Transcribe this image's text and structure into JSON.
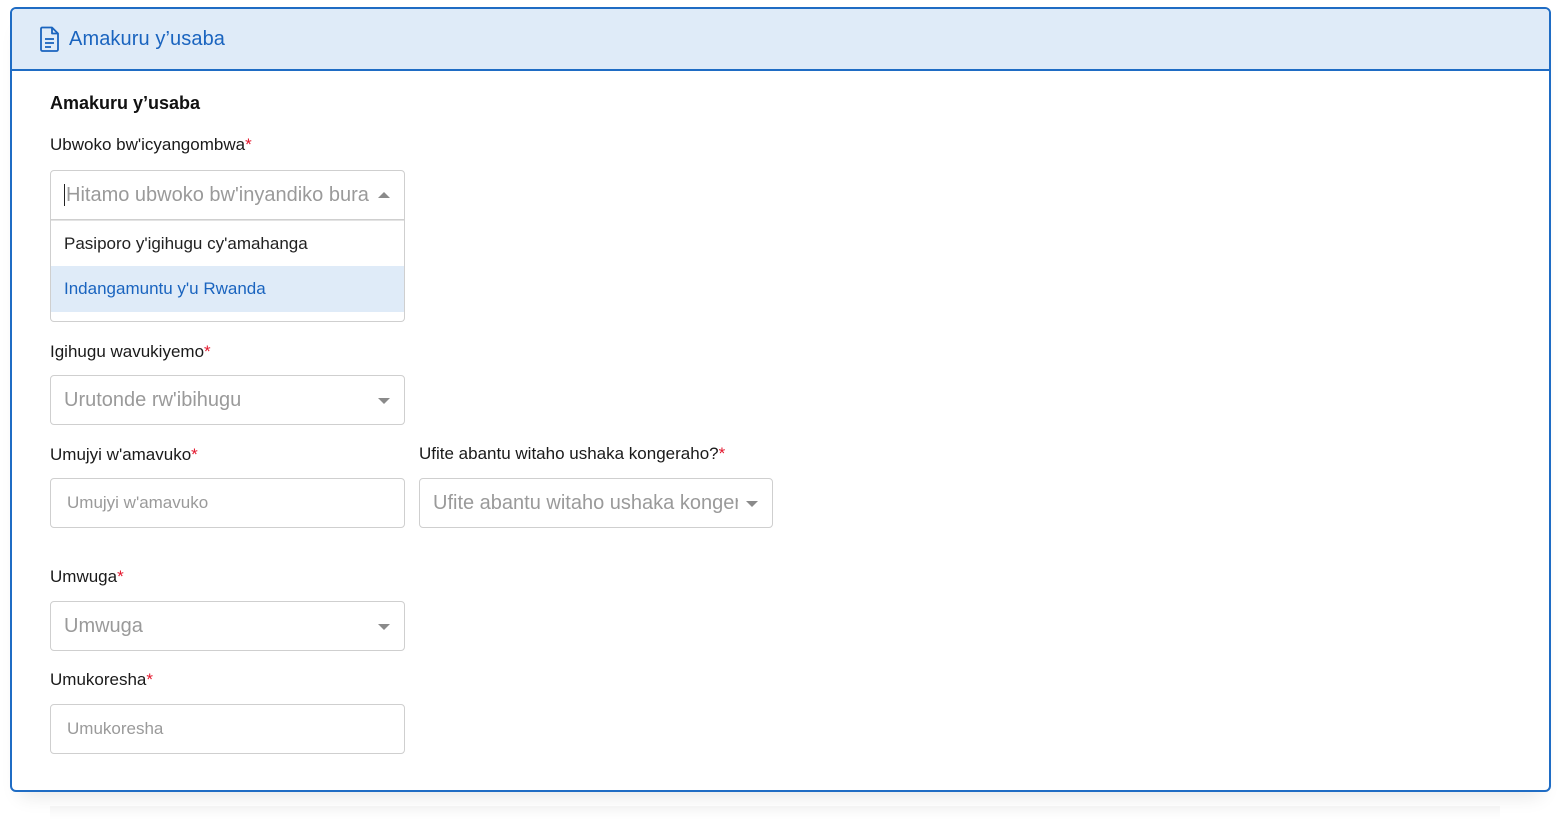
{
  "header": {
    "title": "Amakuru y’usaba",
    "icon": "document-icon"
  },
  "section": {
    "title": "Amakuru y’usaba"
  },
  "required_marker": "*",
  "fields": {
    "document_type": {
      "label": "Ubwoko bw'icyangombwa",
      "placeholder": "Hitamo ubwoko bw'inyandiko bura",
      "options": [
        "Pasiporo y'igihugu cy'amahanga",
        "Indangamuntu y'u Rwanda"
      ],
      "highlighted_option": "Indangamuntu y'u Rwanda"
    },
    "country_of_birth": {
      "label": "Igihugu wavukiyemo",
      "placeholder": "Urutonde rw'ibihugu"
    },
    "city_of_birth": {
      "label": "Umujyi w'amavuko",
      "placeholder": "Umujyi w'amavuko"
    },
    "dependents": {
      "label": "Ufite abantu witaho ushaka kongeraho?",
      "placeholder": "Ufite abantu witaho ushaka kongera"
    },
    "occupation": {
      "label": "Umwuga",
      "placeholder": "Umwuga"
    },
    "employer": {
      "label": "Umukoresha",
      "placeholder": "Umukoresha"
    }
  },
  "colors": {
    "accent": "#1a64bf",
    "header_bg": "#dfebf8",
    "required": "#e3162c"
  }
}
